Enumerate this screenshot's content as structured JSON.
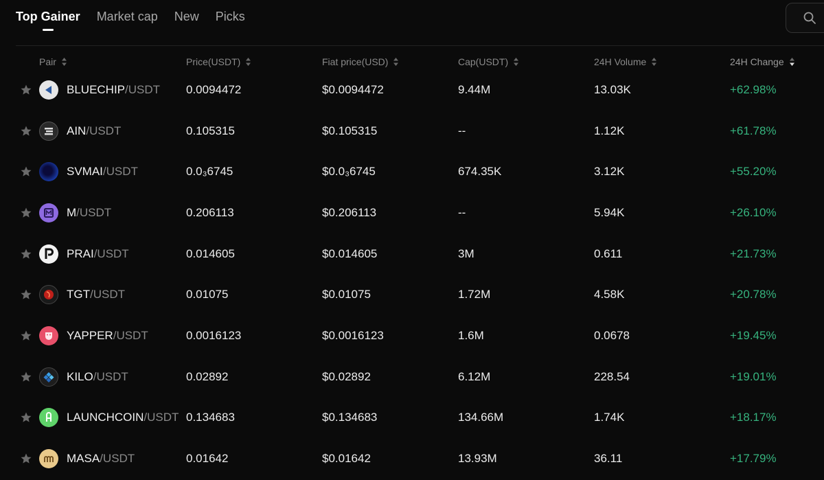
{
  "tabs": [
    {
      "label": "Top Gainer",
      "active": true
    },
    {
      "label": "Market cap",
      "active": false
    },
    {
      "label": "New",
      "active": false
    },
    {
      "label": "Picks",
      "active": false
    }
  ],
  "table": {
    "headers": {
      "pair": "Pair",
      "price": "Price(USDT)",
      "fiat": "Fiat price(USD)",
      "cap": "Cap(USDT)",
      "volume": "24H Volume",
      "change": "24H Change"
    },
    "rows": [
      {
        "base": "BLUECHIP",
        "quote": "/USDT",
        "price": "0.0094472",
        "fiat": "$0.0094472",
        "cap": "9.44M",
        "volume": "13.03K",
        "change": "+62.98%"
      },
      {
        "base": "AIN",
        "quote": "/USDT",
        "price": "0.105315",
        "fiat": "$0.105315",
        "cap": "--",
        "volume": "1.12K",
        "change": "+61.78%"
      },
      {
        "base": "SVMAI",
        "quote": "/USDT",
        "price": "0.0₃6745",
        "fiat": "$0.0₃6745",
        "cap": "674.35K",
        "volume": "3.12K",
        "change": "+55.20%"
      },
      {
        "base": "M",
        "quote": "/USDT",
        "price": "0.206113",
        "fiat": "$0.206113",
        "cap": "--",
        "volume": "5.94K",
        "change": "+26.10%"
      },
      {
        "base": "PRAI",
        "quote": "/USDT",
        "price": "0.014605",
        "fiat": "$0.014605",
        "cap": "3M",
        "volume": "0.611",
        "change": "+21.73%"
      },
      {
        "base": "TGT",
        "quote": "/USDT",
        "price": "0.01075",
        "fiat": "$0.01075",
        "cap": "1.72M",
        "volume": "4.58K",
        "change": "+20.78%"
      },
      {
        "base": "YAPPER",
        "quote": "/USDT",
        "price": "0.0016123",
        "fiat": "$0.0016123",
        "cap": "1.6M",
        "volume": "0.0678",
        "change": "+19.45%"
      },
      {
        "base": "KILO",
        "quote": "/USDT",
        "price": "0.02892",
        "fiat": "$0.02892",
        "cap": "6.12M",
        "volume": "228.54",
        "change": "+19.01%"
      },
      {
        "base": "LAUNCHCOIN",
        "quote": "/USDT",
        "price": "0.134683",
        "fiat": "$0.134683",
        "cap": "134.66M",
        "volume": "1.74K",
        "change": "+18.17%"
      },
      {
        "base": "MASA",
        "quote": "/USDT",
        "price": "0.01642",
        "fiat": "$0.01642",
        "cap": "13.93M",
        "volume": "36.11",
        "change": "+17.79%"
      }
    ]
  },
  "colors": {
    "positive": "#36b37e",
    "background": "#0b0b0b"
  }
}
